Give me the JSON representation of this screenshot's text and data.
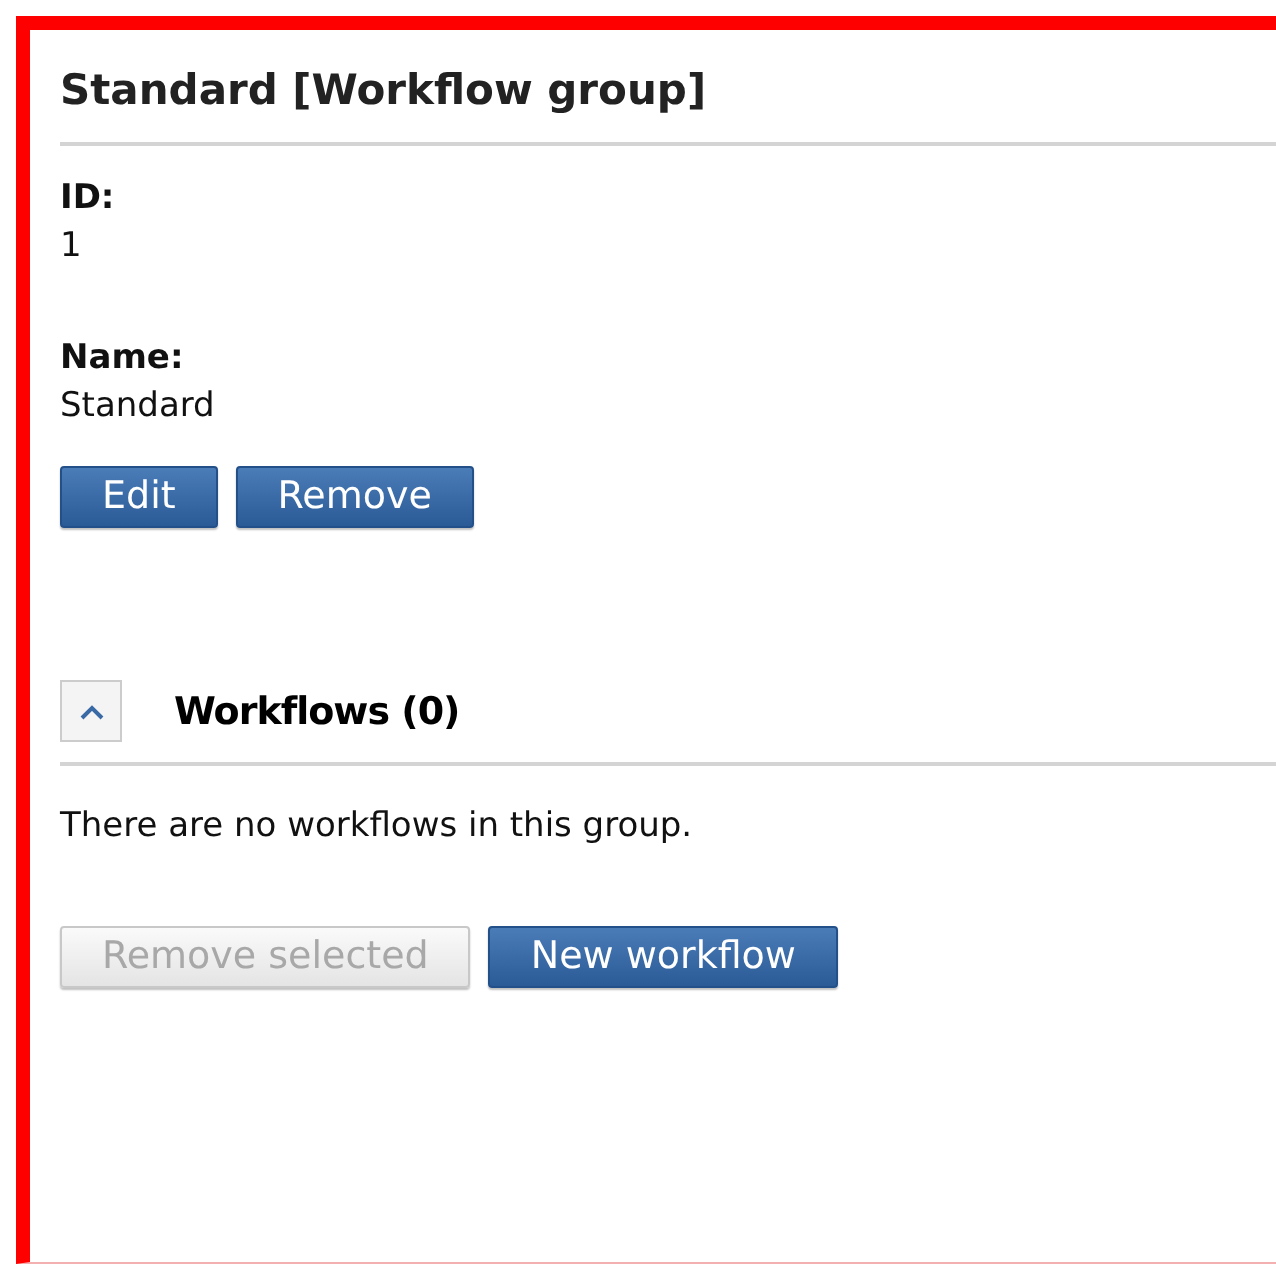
{
  "title": "Standard [Workflow group]",
  "fields": [
    {
      "label": "ID:",
      "value": "1"
    },
    {
      "label": "Name:",
      "value": "Standard"
    }
  ],
  "actions": [
    {
      "label": "Edit",
      "disabled": false
    },
    {
      "label": "Remove",
      "disabled": false
    }
  ],
  "workflows": {
    "title": "Workflows (0)",
    "expanded": true,
    "empty_message": "There are no workflows in this group.",
    "actions": [
      {
        "label": "Remove selected",
        "disabled": true
      },
      {
        "label": "New workflow",
        "disabled": false
      }
    ]
  }
}
